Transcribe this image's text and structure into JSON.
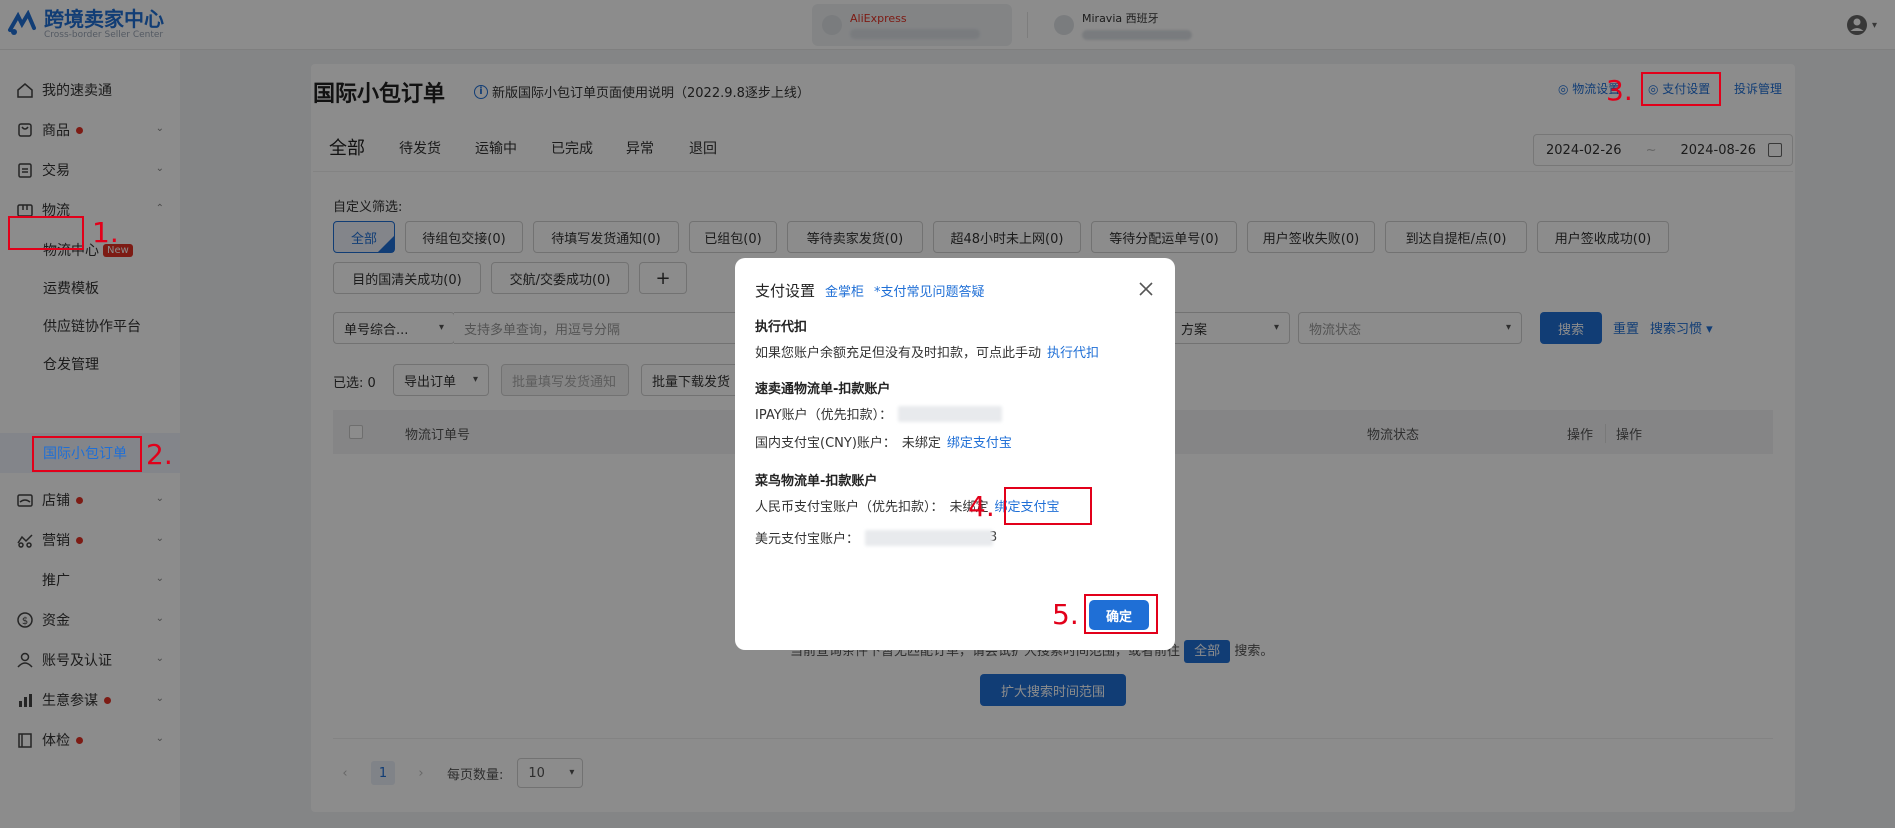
{
  "brand": {
    "name": "跨境卖家中心",
    "subtitle": "Cross-border Seller Center",
    "color": "#1f6fd6"
  },
  "stores": [
    {
      "name": "AliExpress",
      "active": true
    },
    {
      "name": "Miravia 西班牙",
      "active": false
    }
  ],
  "sidebar": {
    "items": [
      {
        "label": "我的速卖通",
        "icon": "home-icon"
      },
      {
        "label": "商品",
        "icon": "package-icon",
        "dot": true
      },
      {
        "label": "交易",
        "icon": "clipboard-icon"
      },
      {
        "label": "物流",
        "icon": "logistics-icon",
        "expanded": true
      },
      {
        "label": "店铺",
        "icon": "store-icon",
        "dot": true
      },
      {
        "label": "营销",
        "icon": "marketing-icon",
        "dot": true
      },
      {
        "label": "推广"
      },
      {
        "label": "资金",
        "icon": "money-icon"
      },
      {
        "label": "账号及认证",
        "icon": "user-icon"
      },
      {
        "label": "生意参谋",
        "icon": "chart-icon",
        "dot": true
      },
      {
        "label": "体检",
        "icon": "checkup-icon",
        "dot": true
      }
    ],
    "logistics_sub": [
      {
        "label": "物流中心",
        "badge": "New"
      },
      {
        "label": "运费模板"
      },
      {
        "label": "供应链协作平台"
      },
      {
        "label": "仓发管理"
      },
      {
        "label": "国际小包订单",
        "active": true
      }
    ]
  },
  "annotations": {
    "n1": "1.",
    "n2": "2.",
    "n3": "3.",
    "n4": "4.",
    "n5": "5.",
    "color": "#e2001a"
  },
  "page": {
    "title": "国际小包订单",
    "note": "新版国际小包订单页面使用说明（2022.9.8逐步上线）",
    "header_links": [
      "物流设置",
      "支付设置",
      "投诉管理"
    ],
    "tabs": [
      "全部",
      "待发货",
      "运输中",
      "已完成",
      "异常",
      "退回"
    ],
    "date_start": "2024-02-26",
    "date_end": "2024-08-26",
    "filter_label": "自定义筛选:",
    "chips_row1": [
      "全部",
      "待组包交接(0)",
      "待填写发货通知(0)",
      "已组包(0)",
      "等待卖家发货(0)",
      "超48小时未上网(0)",
      "等待分配运单号(0)",
      "用户签收失败(0)",
      "到达自提柜/点(0)",
      "用户签收成功(0)"
    ],
    "chips_row2": [
      "目的国清关成功(0)",
      "交航/交委成功(0)",
      "+"
    ],
    "search": {
      "type_select": "单号综合...",
      "placeholder": "支持多单查询，用逗号分隔",
      "plan_select": "方案",
      "status_select": "物流状态",
      "search_btn": "搜索",
      "reset": "重置",
      "habit": "搜索习惯"
    },
    "selected_label": "已选:",
    "selected_count": "0",
    "export_btn": "导出订单",
    "batch_fill_btn": "批量填写发货通知",
    "batch_download_btn": "批量下载发货",
    "table_headers": [
      "物流订单号",
      "物流状态",
      "操作",
      "操作"
    ],
    "empty_prefix": "当前查询条件下暂无匹配订单，请尝试扩大搜索时间范围，或者前往",
    "empty_chip": "全部",
    "empty_suffix": "搜索。",
    "expand_btn": "扩大搜索时间范围",
    "pager": {
      "page": "1",
      "page_size_label": "每页数量:",
      "page_size": "10"
    }
  },
  "modal": {
    "title": "支付设置",
    "link1": "金掌柜",
    "link2": "*支付常见问题答疑",
    "s1_title": "执行代扣",
    "s1_text": "如果您账户余额充足但没有及时扣款，可点此手动",
    "s1_link": "执行代扣",
    "s2_title": "速卖通物流单-扣款账户",
    "s2_ipay": "IPAY账户（优先扣款）：",
    "s2_cny": "国内支付宝(CNY)账户：",
    "s2_cny_status": "未绑定",
    "s2_cny_link": "绑定支付宝",
    "s3_title": "菜鸟物流单-扣款账户",
    "s3_rmb": "人民币支付宝账户（优先扣款）：",
    "s3_rmb_status": "未绑定",
    "s3_rmb_link": "绑定支付宝",
    "s3_usd": "美元支付宝账户：",
    "s3_usd_tail": "3",
    "ok": "确定"
  }
}
